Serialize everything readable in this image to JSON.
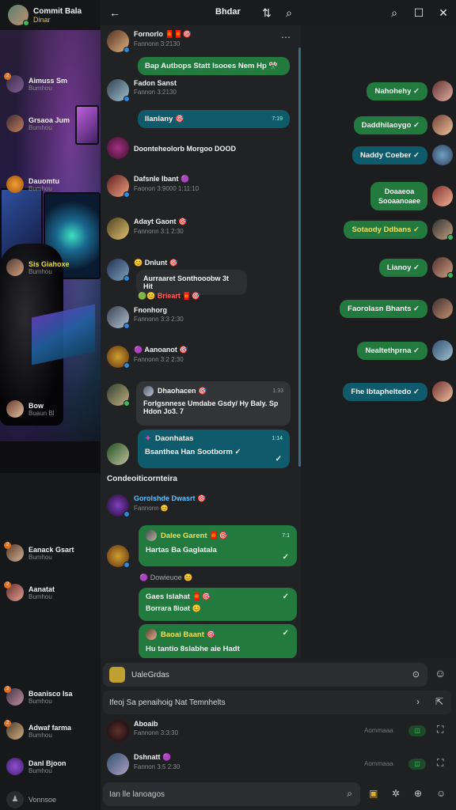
{
  "sidebar": {
    "header": {
      "title": "Commit Bala",
      "subtitle": "Dinar"
    },
    "chats": [
      {
        "name": "Aimuss Sm",
        "sub": "Bumhou",
        "badge": "2"
      },
      {
        "name": "Grsaoa Jum",
        "sub": "Bumhou"
      },
      {
        "name": "Dauomtu",
        "sub": "Bumhou"
      },
      {
        "name": "Sis Giahoxe",
        "sub": "Bumhou"
      },
      {
        "name": "Bow",
        "sub": "Buaun Bl"
      },
      {
        "name": "Eanack Gsart",
        "sub": "Bumhou",
        "badge": "2"
      },
      {
        "name": "Aanatat",
        "sub": "Bumhou",
        "badge": "2"
      },
      {
        "name": "Boanisco Isa",
        "sub": "Bumhou",
        "badge": "2"
      },
      {
        "name": "Adwaf farma",
        "sub": "Bumhou",
        "badge": "2"
      },
      {
        "name": "Danl Bjoon",
        "sub": "Bumhou"
      },
      {
        "name": "Vonnsoe",
        "sub": ""
      }
    ]
  },
  "topbar": {
    "title": "Bhdar",
    "icons": [
      "back-arrow-icon",
      "sort-icon",
      "search-icon",
      "search-icon",
      "window-icon",
      "close-icon"
    ]
  },
  "messages": [
    {
      "name": "Fornorlo 🧧🧧🎯",
      "sub": "Fannonn 3:2130",
      "bubble": "Bap Autbops Statt Isooes Nem Hp 🎌",
      "bubble_style": "green"
    },
    {
      "name": "Fadon Sanst",
      "sub": "Fannon 3:2130",
      "bubble": "Ilanlany 🎯",
      "bubble_time": "7:19",
      "bubble_style": "teal"
    },
    {
      "name": "Doonteheolorb Morgoo DOOD",
      "sub": ""
    },
    {
      "name": "Dafsnle Ibant 🟣",
      "sub": "Faonon 3:9000 1:11:10"
    },
    {
      "name": "Adayt Gaont 🎯",
      "sub": "Fannonn 3:1 2:30"
    },
    {
      "name": "😊 Dnlunt 🎯",
      "sub": "",
      "bubble": "Aurraaret Sonthooobw 3t Hit",
      "bubble_style": "dark"
    },
    {
      "name": "🟢😊 Brieart 🧧🎯",
      "sub": ""
    },
    {
      "name": "Fnonhorg",
      "sub": "Fannonn 3:3 2:30"
    },
    {
      "name": "🟣 Aanoanot 🎯",
      "sub": "Fannonn 3:2 2:30"
    },
    {
      "name": "Dhaohacen 🎯",
      "sub": "",
      "bubble": "Forlgsnnese Umdabe Gsdy/ Hy Baly. Sp Hdon Jo3. 7",
      "bubble_time": "1:33",
      "bubble_style": "grey"
    },
    {
      "name": "Daonhatas",
      "sub": "",
      "bubble": "Bsanthea Han Sootborm ✓",
      "bubble_time": "1:14",
      "bubble_style": "teal"
    }
  ],
  "section": {
    "label": "Condeoiticornteira"
  },
  "group_messages": [
    {
      "name": "Gorolshde Dwasrt 🎯",
      "sub": "Fannonn 😊"
    },
    {
      "name": "Dalee Garent 🧧🎯",
      "sub": "Hartas Ba Gaglatala",
      "time": "7:1"
    },
    {
      "name": "🟣 Dowieuoe 😊",
      "sub": ""
    },
    {
      "name": "Gaes Islahat 🧧🎯",
      "sub": "Borrara 8ioat 😊"
    },
    {
      "name": "Baoai Baant 🎯",
      "sub": "Hu tantio 8slabhe aie Hadt"
    }
  ],
  "outgoing": [
    {
      "text": "Nahohehy ✓",
      "style": "green"
    },
    {
      "text": "Daddhilaoygo ✓",
      "style": "green"
    },
    {
      "text": "Naddy Coeber ✓",
      "style": "teal"
    },
    {
      "text": "Doaaeoa Sooaanoaee",
      "style": "green"
    },
    {
      "text": "Sotaody Ddbans ✓",
      "style": "yellow"
    },
    {
      "text": "Lianoy ✓",
      "style": "green"
    },
    {
      "text": "Faorolasn Bhants ✓",
      "style": "teal"
    },
    {
      "text": "Nealtethprna ✓",
      "style": "green"
    },
    {
      "text": "Fhe Ibtapheltedo ✓",
      "style": "teal"
    }
  ],
  "bottom": {
    "input1": "UaleGrdas",
    "input2": "Ifeoj Sa penaihoig Nat Temnhelts",
    "row1": {
      "name": "Aboaib",
      "sub": "Fannonn 3:3:30",
      "meta": "Aommaaa"
    },
    "row2": {
      "name": "Dshnatt 🟣",
      "sub": "Fannon 3:5 2:30",
      "meta": "Aommaaa"
    },
    "compose_placeholder": "Ian lle lanoagos"
  },
  "colors": {
    "accent_green": "#237a3e",
    "accent_teal": "#0f5b6c",
    "background": "#1b1c1e"
  }
}
